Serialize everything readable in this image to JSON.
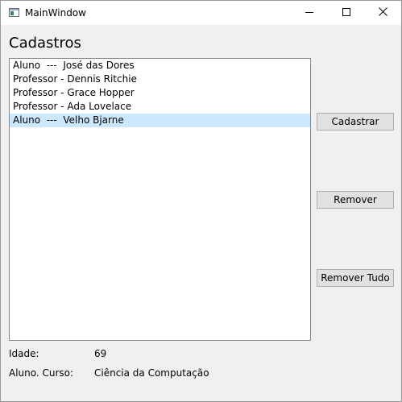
{
  "window": {
    "title": "MainWindow",
    "icon": "app-window-icon",
    "controls": [
      "minimize-icon",
      "maximize-icon",
      "close-icon"
    ]
  },
  "main": {
    "heading": "Cadastros",
    "list": {
      "items": [
        {
          "text": "Aluno  ---  José das Dores",
          "selected": false
        },
        {
          "text": "Professor - Dennis Ritchie",
          "selected": false
        },
        {
          "text": "Professor - Grace Hopper",
          "selected": false
        },
        {
          "text": "Professor - Ada Lovelace",
          "selected": false
        },
        {
          "text": "Aluno  ---  Velho Bjarne",
          "selected": true
        }
      ],
      "selected_color": "#cce8ff"
    },
    "buttons": {
      "cadastrar": "Cadastrar",
      "remover": "Remover",
      "remover_tudo": "Remover Tudo"
    },
    "details": {
      "idade_label": "Idade:",
      "idade_value": "69",
      "curso_label": "Aluno. Curso:",
      "curso_value": "Ciência da Computação"
    }
  }
}
